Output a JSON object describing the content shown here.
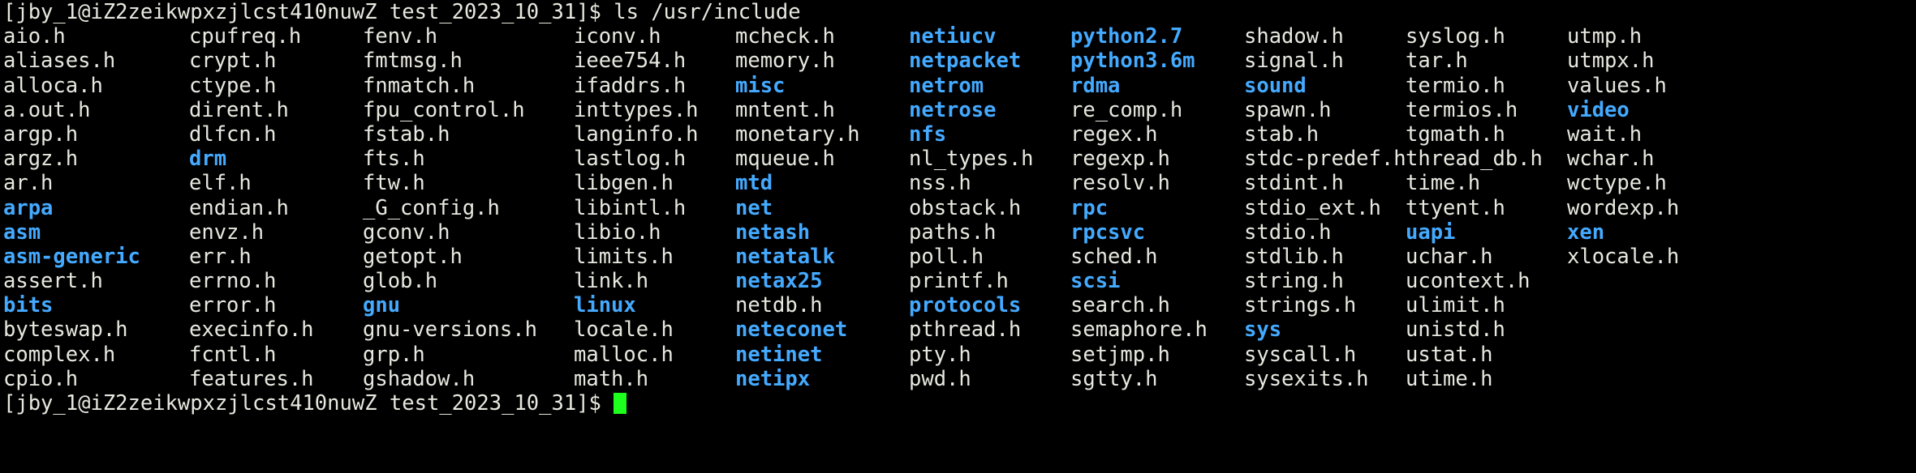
{
  "terminal": {
    "background_color": "#000000",
    "foreground_color": "#e8e8e0",
    "directory_color": "#44aaff",
    "cursor_color": "#1dff1d",
    "user_host": "[jby_1@iZ2zeikwpxzjlcst410nuwZ test_2023_10_31]$",
    "command": " ls /usr/include",
    "top_prompt": "[jby_1@iZ2zeikwpxzjlcst410nuwZ test_2023_10_31]$",
    "top_command": " ls /usr/include",
    "bottom_prompt": "[jby_1@iZ2zeikwpxzjlcst410nuwZ test_2023_10_31]$",
    "bottom_command": "",
    "cursor_visible": true
  },
  "listing": {
    "columns": 10,
    "rows": [
      [
        {
          "name": "aio.h",
          "type": "file"
        },
        {
          "name": "cpufreq.h",
          "type": "file"
        },
        {
          "name": "fenv.h",
          "type": "file"
        },
        {
          "name": "iconv.h",
          "type": "file"
        },
        {
          "name": "mcheck.h",
          "type": "file"
        },
        {
          "name": "netiucv",
          "type": "dir"
        },
        {
          "name": "python2.7",
          "type": "dir"
        },
        {
          "name": "shadow.h",
          "type": "file"
        },
        {
          "name": "syslog.h",
          "type": "file"
        },
        {
          "name": "utmp.h",
          "type": "file"
        }
      ],
      [
        {
          "name": "aliases.h",
          "type": "file"
        },
        {
          "name": "crypt.h",
          "type": "file"
        },
        {
          "name": "fmtmsg.h",
          "type": "file"
        },
        {
          "name": "ieee754.h",
          "type": "file"
        },
        {
          "name": "memory.h",
          "type": "file"
        },
        {
          "name": "netpacket",
          "type": "dir"
        },
        {
          "name": "python3.6m",
          "type": "dir"
        },
        {
          "name": "signal.h",
          "type": "file"
        },
        {
          "name": "tar.h",
          "type": "file"
        },
        {
          "name": "utmpx.h",
          "type": "file"
        }
      ],
      [
        {
          "name": "alloca.h",
          "type": "file"
        },
        {
          "name": "ctype.h",
          "type": "file"
        },
        {
          "name": "fnmatch.h",
          "type": "file"
        },
        {
          "name": "ifaddrs.h",
          "type": "file"
        },
        {
          "name": "misc",
          "type": "dir"
        },
        {
          "name": "netrom",
          "type": "dir"
        },
        {
          "name": "rdma",
          "type": "dir"
        },
        {
          "name": "sound",
          "type": "dir"
        },
        {
          "name": "termio.h",
          "type": "file"
        },
        {
          "name": "values.h",
          "type": "file"
        }
      ],
      [
        {
          "name": "a.out.h",
          "type": "file"
        },
        {
          "name": "dirent.h",
          "type": "file"
        },
        {
          "name": "fpu_control.h",
          "type": "file"
        },
        {
          "name": "inttypes.h",
          "type": "file"
        },
        {
          "name": "mntent.h",
          "type": "file"
        },
        {
          "name": "netrose",
          "type": "dir"
        },
        {
          "name": "re_comp.h",
          "type": "file"
        },
        {
          "name": "spawn.h",
          "type": "file"
        },
        {
          "name": "termios.h",
          "type": "file"
        },
        {
          "name": "video",
          "type": "dir"
        }
      ],
      [
        {
          "name": "argp.h",
          "type": "file"
        },
        {
          "name": "dlfcn.h",
          "type": "file"
        },
        {
          "name": "fstab.h",
          "type": "file"
        },
        {
          "name": "langinfo.h",
          "type": "file"
        },
        {
          "name": "monetary.h",
          "type": "file"
        },
        {
          "name": "nfs",
          "type": "dir"
        },
        {
          "name": "regex.h",
          "type": "file"
        },
        {
          "name": "stab.h",
          "type": "file"
        },
        {
          "name": "tgmath.h",
          "type": "file"
        },
        {
          "name": "wait.h",
          "type": "file"
        }
      ],
      [
        {
          "name": "argz.h",
          "type": "file"
        },
        {
          "name": "drm",
          "type": "dir"
        },
        {
          "name": "fts.h",
          "type": "file"
        },
        {
          "name": "lastlog.h",
          "type": "file"
        },
        {
          "name": "mqueue.h",
          "type": "file"
        },
        {
          "name": "nl_types.h",
          "type": "file"
        },
        {
          "name": "regexp.h",
          "type": "file"
        },
        {
          "name": "stdc-predef.h",
          "type": "file"
        },
        {
          "name": "thread_db.h",
          "type": "file"
        },
        {
          "name": "wchar.h",
          "type": "file"
        }
      ],
      [
        {
          "name": "ar.h",
          "type": "file"
        },
        {
          "name": "elf.h",
          "type": "file"
        },
        {
          "name": "ftw.h",
          "type": "file"
        },
        {
          "name": "libgen.h",
          "type": "file"
        },
        {
          "name": "mtd",
          "type": "dir"
        },
        {
          "name": "nss.h",
          "type": "file"
        },
        {
          "name": "resolv.h",
          "type": "file"
        },
        {
          "name": "stdint.h",
          "type": "file"
        },
        {
          "name": "time.h",
          "type": "file"
        },
        {
          "name": "wctype.h",
          "type": "file"
        }
      ],
      [
        {
          "name": "arpa",
          "type": "dir"
        },
        {
          "name": "endian.h",
          "type": "file"
        },
        {
          "name": "_G_config.h",
          "type": "file"
        },
        {
          "name": "libintl.h",
          "type": "file"
        },
        {
          "name": "net",
          "type": "dir"
        },
        {
          "name": "obstack.h",
          "type": "file"
        },
        {
          "name": "rpc",
          "type": "dir"
        },
        {
          "name": "stdio_ext.h",
          "type": "file"
        },
        {
          "name": "ttyent.h",
          "type": "file"
        },
        {
          "name": "wordexp.h",
          "type": "file"
        }
      ],
      [
        {
          "name": "asm",
          "type": "dir"
        },
        {
          "name": "envz.h",
          "type": "file"
        },
        {
          "name": "gconv.h",
          "type": "file"
        },
        {
          "name": "libio.h",
          "type": "file"
        },
        {
          "name": "netash",
          "type": "dir"
        },
        {
          "name": "paths.h",
          "type": "file"
        },
        {
          "name": "rpcsvc",
          "type": "dir"
        },
        {
          "name": "stdio.h",
          "type": "file"
        },
        {
          "name": "uapi",
          "type": "dir"
        },
        {
          "name": "xen",
          "type": "dir"
        }
      ],
      [
        {
          "name": "asm-generic",
          "type": "dir"
        },
        {
          "name": "err.h",
          "type": "file"
        },
        {
          "name": "getopt.h",
          "type": "file"
        },
        {
          "name": "limits.h",
          "type": "file"
        },
        {
          "name": "netatalk",
          "type": "dir"
        },
        {
          "name": "poll.h",
          "type": "file"
        },
        {
          "name": "sched.h",
          "type": "file"
        },
        {
          "name": "stdlib.h",
          "type": "file"
        },
        {
          "name": "uchar.h",
          "type": "file"
        },
        {
          "name": "xlocale.h",
          "type": "file"
        }
      ],
      [
        {
          "name": "assert.h",
          "type": "file"
        },
        {
          "name": "errno.h",
          "type": "file"
        },
        {
          "name": "glob.h",
          "type": "file"
        },
        {
          "name": "link.h",
          "type": "file"
        },
        {
          "name": "netax25",
          "type": "dir"
        },
        {
          "name": "printf.h",
          "type": "file"
        },
        {
          "name": "scsi",
          "type": "dir"
        },
        {
          "name": "string.h",
          "type": "file"
        },
        {
          "name": "ucontext.h",
          "type": "file"
        },
        {
          "name": "",
          "type": "file"
        }
      ],
      [
        {
          "name": "bits",
          "type": "dir"
        },
        {
          "name": "error.h",
          "type": "file"
        },
        {
          "name": "gnu",
          "type": "dir"
        },
        {
          "name": "linux",
          "type": "dir"
        },
        {
          "name": "netdb.h",
          "type": "file"
        },
        {
          "name": "protocols",
          "type": "dir"
        },
        {
          "name": "search.h",
          "type": "file"
        },
        {
          "name": "strings.h",
          "type": "file"
        },
        {
          "name": "ulimit.h",
          "type": "file"
        },
        {
          "name": "",
          "type": "file"
        }
      ],
      [
        {
          "name": "byteswap.h",
          "type": "file"
        },
        {
          "name": "execinfo.h",
          "type": "file"
        },
        {
          "name": "gnu-versions.h",
          "type": "file"
        },
        {
          "name": "locale.h",
          "type": "file"
        },
        {
          "name": "neteconet",
          "type": "dir"
        },
        {
          "name": "pthread.h",
          "type": "file"
        },
        {
          "name": "semaphore.h",
          "type": "file"
        },
        {
          "name": "sys",
          "type": "dir"
        },
        {
          "name": "unistd.h",
          "type": "file"
        },
        {
          "name": "",
          "type": "file"
        }
      ],
      [
        {
          "name": "complex.h",
          "type": "file"
        },
        {
          "name": "fcntl.h",
          "type": "file"
        },
        {
          "name": "grp.h",
          "type": "file"
        },
        {
          "name": "malloc.h",
          "type": "file"
        },
        {
          "name": "netinet",
          "type": "dir"
        },
        {
          "name": "pty.h",
          "type": "file"
        },
        {
          "name": "setjmp.h",
          "type": "file"
        },
        {
          "name": "syscall.h",
          "type": "file"
        },
        {
          "name": "ustat.h",
          "type": "file"
        },
        {
          "name": "",
          "type": "file"
        }
      ],
      [
        {
          "name": "cpio.h",
          "type": "file"
        },
        {
          "name": "features.h",
          "type": "file"
        },
        {
          "name": "gshadow.h",
          "type": "file"
        },
        {
          "name": "math.h",
          "type": "file"
        },
        {
          "name": "netipx",
          "type": "dir"
        },
        {
          "name": "pwd.h",
          "type": "file"
        },
        {
          "name": "sgtty.h",
          "type": "file"
        },
        {
          "name": "sysexits.h",
          "type": "file"
        },
        {
          "name": "utime.h",
          "type": "file"
        },
        {
          "name": "",
          "type": "file"
        }
      ]
    ]
  }
}
